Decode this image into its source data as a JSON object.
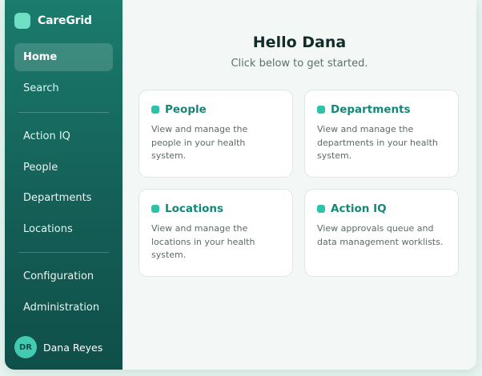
{
  "brand": {
    "name": "CareGrid"
  },
  "sidebar": {
    "items": [
      {
        "label": "Home",
        "active": true
      },
      {
        "label": "Search"
      },
      {
        "label": "Action IQ"
      },
      {
        "label": "People"
      },
      {
        "label": "Departments"
      },
      {
        "label": "Locations"
      },
      {
        "label": "Configuration"
      },
      {
        "label": "Administration"
      }
    ],
    "user": {
      "initials": "DR",
      "name": "Dana Reyes"
    }
  },
  "main": {
    "greeting": "Hello Dana",
    "subtitle": "Click below to get started.",
    "cards": [
      {
        "title": "People",
        "description": "View and manage the people in your health system."
      },
      {
        "title": "Departments",
        "description": "View and manage the departments in your health system."
      },
      {
        "title": "Locations",
        "description": "View and manage the locations in your health system."
      },
      {
        "title": "Action IQ",
        "description": "View approvals queue and data management worklists."
      }
    ]
  },
  "colors": {
    "sidebar_top": "#1a7c6d",
    "sidebar_bottom": "#0f4f49",
    "accent": "#2cc4a8",
    "card_title": "#148777",
    "page_background": "#f3f7f6"
  }
}
